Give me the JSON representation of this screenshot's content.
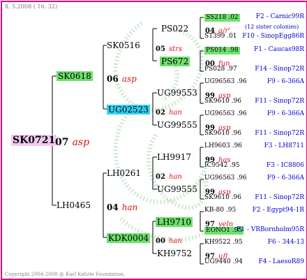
{
  "header": {
    "date": "8. 5.2008 ( 16: 32)"
  },
  "footer": {
    "copyright": "Copyright 2004-2008 @ Karl Kehrle Foundation."
  },
  "colors": {
    "frame": "#e0007a",
    "highlight_green": "#6ee06e",
    "highlight_pink": "#f2c8f2",
    "highlight_blue": "#33d0f0",
    "name_red": "#e01010",
    "location_blue": "#0000cc"
  },
  "root": {
    "id": "SK0721",
    "num": "07",
    "name": "asp"
  },
  "father": {
    "id": "SK0618",
    "num": "06",
    "name": "asp"
  },
  "mother": {
    "id": "LH0465",
    "num": "04",
    "name": "han"
  },
  "ff": {
    "id": "SK0516",
    "num": "05",
    "name": "strs"
  },
  "fm": {
    "id": "UG02523",
    "num": "02",
    "name": "han"
  },
  "mf": {
    "id": "LH0261",
    "num": "02",
    "name": "han"
  },
  "mm": {
    "id": "KDK0004",
    "num": "00",
    "name": "han"
  },
  "gen3": [
    {
      "id": "PS022"
    },
    {
      "id": "PS672"
    },
    {
      "id": "UG99553"
    },
    {
      "id": "UG99555"
    },
    {
      "id": "LH9917"
    },
    {
      "id": "UG99555"
    },
    {
      "id": "LH9710"
    },
    {
      "id": "KH9752"
    }
  ],
  "gen4": [
    {
      "top": "SS218 .02",
      "top_loc": "F2 - Carnic99R",
      "num": "04",
      "name": "a/r'",
      "note": "(12 sister colonies)",
      "bottom": "ST399 .01",
      "bottom_loc": "F10 - SinopEgg86R"
    },
    {
      "top": "PS014 .98",
      "top_loc": "F1 - Caucas98R",
      "num": "00",
      "name": "fun",
      "note": "",
      "bottom": "PS028 .97",
      "bottom_loc": "F14 - Sinop72R"
    },
    {
      "top": "UG96563 .96",
      "top_loc": "F9 - 6-366A",
      "num": "99",
      "name": "asp",
      "note": "",
      "bottom": "SK9610 .96",
      "bottom_loc": "F11 - Sinop72R"
    },
    {
      "top": "UG96563 .96",
      "top_loc": "F9 - 6-366A",
      "num": "99",
      "name": "asp",
      "note": "",
      "bottom": "SK9610 .96",
      "bottom_loc": "F11 - Sinop72R"
    },
    {
      "top": "LH9603 .96",
      "top_loc": "F3 - LH8711",
      "num": "99",
      "name": "has",
      "note": "",
      "bottom": "IC9542 .95",
      "bottom_loc": "F3 - IC8806"
    },
    {
      "top": "UG96563 .96",
      "top_loc": "F9 - 6-366A",
      "num": "99",
      "name": "asp",
      "note": "",
      "bottom": "SK9610 .96",
      "bottom_loc": "F11 - Sinop72R"
    },
    {
      "top": "KB-80 .95",
      "top_loc": "F2 - Egypt94-1R",
      "num": "97",
      "name": "veln",
      "note": "",
      "bottom": "EONO1 .95",
      "bottom_loc": "F1 - VRBornholm95R"
    },
    {
      "top": "KH9522 .95",
      "top_loc": "F6 - 344-13",
      "num": "97",
      "name": "ufl",
      "note": "",
      "bottom": "UG9440 .94",
      "bottom_loc": "F4 - LaesoR89"
    }
  ]
}
